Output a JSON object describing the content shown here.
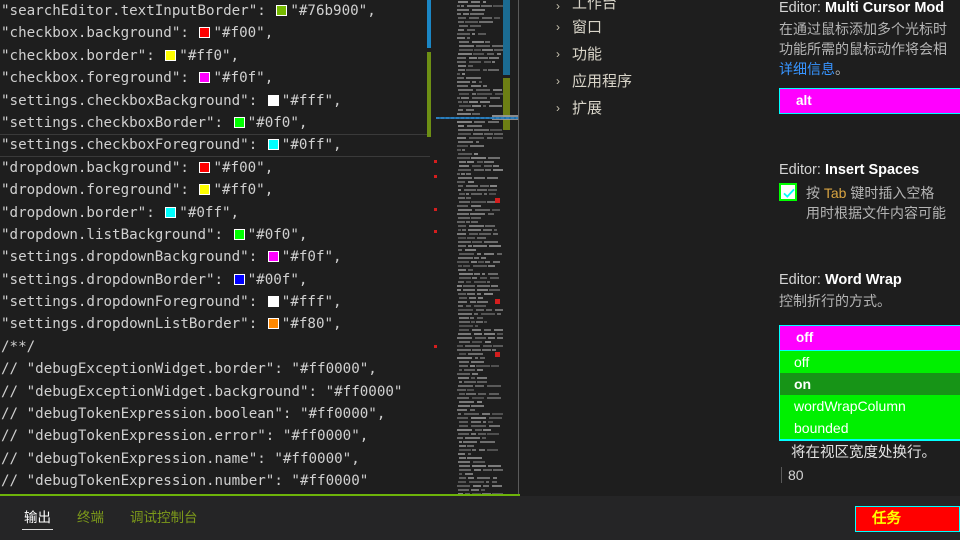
{
  "editor": {
    "lines": [
      {
        "text": "\"searchEditor.textInputBorder\": ",
        "swatch": "#76b900",
        "value": "\"#76b900\","
      },
      {
        "text": "\"checkbox.background\": ",
        "swatch": "#ff0000",
        "value": "\"#f00\","
      },
      {
        "text": "\"checkbox.border\": ",
        "swatch": "#ffff00",
        "value": "\"#ff0\","
      },
      {
        "text": "\"checkbox.foreground\": ",
        "swatch": "#ff00ff",
        "value": "\"#f0f\","
      },
      {
        "text": "\"settings.checkboxBackground\": ",
        "swatch": "#ffffff",
        "value": "\"#fff\","
      },
      {
        "text": "\"settings.checkboxBorder\": ",
        "swatch": "#00ff00",
        "value": "\"#0f0\","
      },
      {
        "text": "\"settings.checkboxForeground\": ",
        "swatch": "#00ffff",
        "value": "\"#0ff\","
      },
      {
        "text": "\"dropdown.background\": ",
        "swatch": "#ff0000",
        "value": "\"#f00\","
      },
      {
        "text": "\"dropdown.foreground\": ",
        "swatch": "#ffff00",
        "value": "\"#ff0\","
      },
      {
        "text": "\"dropdown.border\": ",
        "swatch": "#00ffff",
        "value": "\"#0ff\","
      },
      {
        "text": "\"dropdown.listBackground\": ",
        "swatch": "#00ff00",
        "value": "\"#0f0\","
      },
      {
        "text": "\"settings.dropdownBackground\": ",
        "swatch": "#ff00ff",
        "value": "\"#f0f\","
      },
      {
        "text": "\"settings.dropdownBorder\": ",
        "swatch": "#0000ff",
        "value": "\"#00f\","
      },
      {
        "text": "\"settings.dropdownForeground\": ",
        "swatch": "#ffffff",
        "value": "\"#fff\","
      },
      {
        "text": "\"settings.dropdownListBorder\": ",
        "swatch": "#ff8800",
        "value": "\"#f80\","
      },
      {
        "text": "/**/",
        "swatch": null,
        "value": ""
      },
      {
        "text": "// \"debugExceptionWidget.border\": \"#ff0000\",",
        "swatch": null,
        "value": ""
      },
      {
        "text": "// \"debugExceptionWidget.background\": \"#ff0000\"",
        "swatch": null,
        "value": ""
      },
      {
        "text": "// \"debugTokenExpression.boolean\": \"#ff0000\",",
        "swatch": null,
        "value": ""
      },
      {
        "text": "// \"debugTokenExpression.error\": \"#ff0000\",",
        "swatch": null,
        "value": ""
      },
      {
        "text": "// \"debugTokenExpression.name\": \"#ff0000\",",
        "swatch": null,
        "value": ""
      },
      {
        "text": "// \"debugTokenExpression.number\": \"#ff0000\"",
        "swatch": null,
        "value": ""
      }
    ],
    "current_line_index": 6
  },
  "toc": {
    "items": [
      {
        "label": "工作台",
        "chevron": "›",
        "clipped": true
      },
      {
        "label": "窗口",
        "chevron": "›",
        "clipped": false
      },
      {
        "label": "功能",
        "chevron": "›",
        "clipped": false
      },
      {
        "label": "应用程序",
        "chevron": "›",
        "clipped": false
      },
      {
        "label": "扩展",
        "chevron": "›",
        "clipped": false
      }
    ]
  },
  "settings": {
    "multi_cursor": {
      "title_prefix": "Editor: ",
      "title": "Multi Cursor Mod",
      "desc_line1": "在通过鼠标添加多个光标时",
      "desc_line2": "功能所需的鼠标动作将会相",
      "link": "详细信息",
      "link_suffix": "。",
      "select_value": "alt"
    },
    "insert_spaces": {
      "title_prefix": "Editor: ",
      "title": "Insert Spaces",
      "desc_line1_a": "按 ",
      "desc_line1_code": "Tab",
      "desc_line1_b": " 键时插入空格",
      "desc_line2": "用时根据文件内容可能",
      "checked": true
    },
    "word_wrap": {
      "title_prefix": "Editor: ",
      "title": "Word Wrap",
      "desc": "控制折行的方式。",
      "select_value": "off",
      "options": [
        "off",
        "on",
        "wordWrapColumn",
        "bounded"
      ],
      "selected_option_index": 1,
      "option_desc": "将在视区宽度处换行。",
      "next_value": "80"
    }
  },
  "panel": {
    "tabs": [
      {
        "label": "输出",
        "active": true
      },
      {
        "label": "终端",
        "active": false
      },
      {
        "label": "调试控制台",
        "active": false
      }
    ],
    "task_button": "任务"
  },
  "theme": {
    "dropdown_background": "#ff0000",
    "dropdown_foreground": "#ffff00",
    "dropdown_border": "#00ffff",
    "dropdown_list_background": "#00ff00",
    "settings_dropdown_background": "#ff00ff",
    "settings_checkbox_background": "#ffffff",
    "settings_checkbox_border": "#00ff00",
    "settings_checkbox_foreground": "#00ffff",
    "editor_border_green": "#6db30a"
  }
}
